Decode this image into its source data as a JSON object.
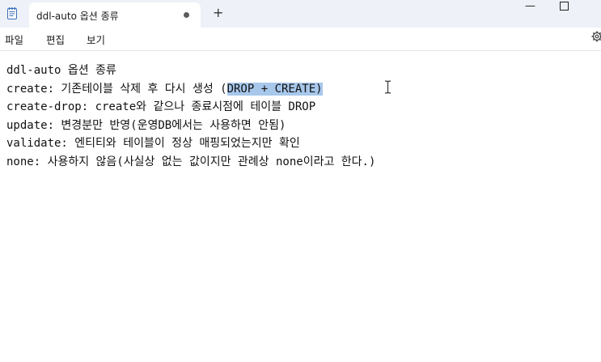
{
  "tab": {
    "title": "ddl-auto 옵션 종류",
    "new_tab_symbol": "+"
  },
  "window_controls": {
    "minimize": "—",
    "maximize": "☐"
  },
  "menu": {
    "file": "파일",
    "edit": "편집",
    "view": "보기"
  },
  "icons": {
    "app": "notepad-icon",
    "settings": "gear-icon",
    "unsaved": "unsaved-dot-icon",
    "cursor": "text-cursor-icon"
  },
  "colors": {
    "titlebar": "#eef1f7",
    "selection": "#a7c7eb"
  },
  "editor": {
    "line1": "ddl-auto 옵션 종류",
    "line2_prefix": "create: 기존테이블 삭제 후 다시 생성 (",
    "line2_selected": "DROP + CREATE)",
    "line3": "create-drop: create와 같으나 종료시점에 테이블 DROP",
    "line4": "update: 변경분만 반영(운영DB에서는 사용하면 안됨)",
    "line5": "validate: 엔티티와 테이블이 정상 매핑되었는지만 확인",
    "line6": "none: 사용하지 않음(사실상 없는 값이지만 관례상 none이라고 한다.)"
  }
}
